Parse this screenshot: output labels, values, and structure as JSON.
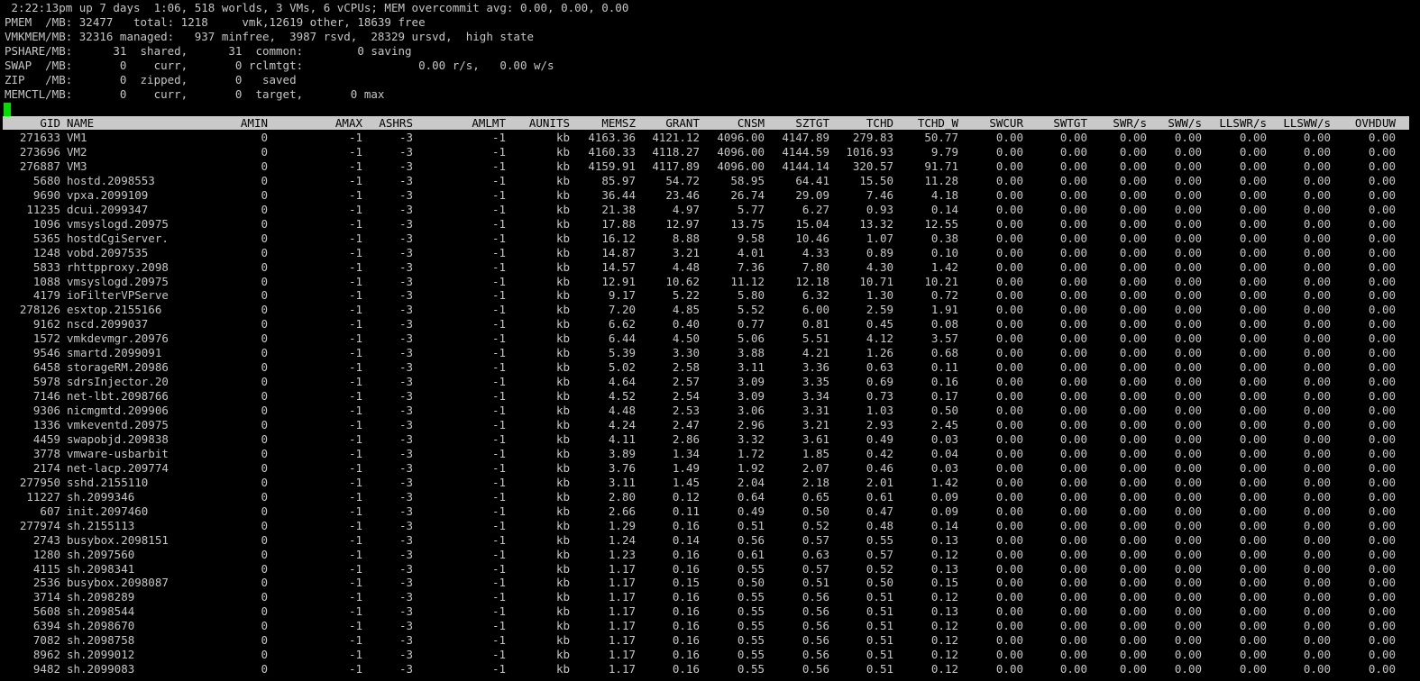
{
  "summary": {
    "line1": " 2:22:13pm up 7 days  1:06, 518 worlds, 3 VMs, 6 vCPUs; MEM overcommit avg: 0.00, 0.00, 0.00",
    "line2": "PMEM  /MB: 32477   total: 1218     vmk,12619 other, 18639 free",
    "line3": "VMKMEM/MB: 32316 managed:   937 minfree,  3987 rsvd,  28329 ursvd,  high state",
    "line4": "PSHARE/MB:      31  shared,      31  common:        0 saving",
    "line5": "SWAP  /MB:       0    curr,       0 rclmtgt:                 0.00 r/s,   0.00 w/s",
    "line6": "ZIP   /MB:       0  zipped,       0   saved",
    "line7": "MEMCTL/MB:       0    curr,       0  target,       0 max"
  },
  "columns": [
    "GID",
    "NAME",
    "AMIN",
    "AMAX",
    "ASHRS",
    "AMLMT",
    "AUNITS",
    "MEMSZ",
    "GRANT",
    "CNSM",
    "SZTGT",
    "TCHD",
    "TCHD_W",
    "SWCUR",
    "SWTGT",
    "SWR/s",
    "SWW/s",
    "LLSWR/s",
    "LLSWW/s",
    "OVHDUW"
  ],
  "rows": [
    [
      "271633",
      "VM1",
      "0",
      "-1",
      "-3",
      "-1",
      "kb",
      "4163.36",
      "4121.12",
      "4096.00",
      "4147.89",
      "279.83",
      "50.77",
      "0.00",
      "0.00",
      "0.00",
      "0.00",
      "0.00",
      "0.00",
      "0.00"
    ],
    [
      "273696",
      "VM2",
      "0",
      "-1",
      "-3",
      "-1",
      "kb",
      "4160.33",
      "4118.27",
      "4096.00",
      "4144.59",
      "1016.93",
      "9.79",
      "0.00",
      "0.00",
      "0.00",
      "0.00",
      "0.00",
      "0.00",
      "0.00"
    ],
    [
      "276887",
      "VM3",
      "0",
      "-1",
      "-3",
      "-1",
      "kb",
      "4159.91",
      "4117.89",
      "4096.00",
      "4144.14",
      "320.57",
      "91.71",
      "0.00",
      "0.00",
      "0.00",
      "0.00",
      "0.00",
      "0.00",
      "0.00"
    ],
    [
      "5680",
      "hostd.2098553",
      "0",
      "-1",
      "-3",
      "-1",
      "kb",
      "85.97",
      "54.72",
      "58.95",
      "64.41",
      "15.50",
      "11.28",
      "0.00",
      "0.00",
      "0.00",
      "0.00",
      "0.00",
      "0.00",
      "0.00"
    ],
    [
      "9690",
      "vpxa.2099109",
      "0",
      "-1",
      "-3",
      "-1",
      "kb",
      "36.44",
      "23.46",
      "26.74",
      "29.09",
      "7.46",
      "4.18",
      "0.00",
      "0.00",
      "0.00",
      "0.00",
      "0.00",
      "0.00",
      "0.00"
    ],
    [
      "11235",
      "dcui.2099347",
      "0",
      "-1",
      "-3",
      "-1",
      "kb",
      "21.38",
      "4.97",
      "5.77",
      "6.27",
      "0.93",
      "0.14",
      "0.00",
      "0.00",
      "0.00",
      "0.00",
      "0.00",
      "0.00",
      "0.00"
    ],
    [
      "1096",
      "vmsyslogd.20975",
      "0",
      "-1",
      "-3",
      "-1",
      "kb",
      "17.88",
      "12.97",
      "13.75",
      "15.04",
      "13.32",
      "12.55",
      "0.00",
      "0.00",
      "0.00",
      "0.00",
      "0.00",
      "0.00",
      "0.00"
    ],
    [
      "5365",
      "hostdCgiServer.",
      "0",
      "-1",
      "-3",
      "-1",
      "kb",
      "16.12",
      "8.88",
      "9.58",
      "10.46",
      "1.07",
      "0.38",
      "0.00",
      "0.00",
      "0.00",
      "0.00",
      "0.00",
      "0.00",
      "0.00"
    ],
    [
      "1248",
      "vobd.2097535",
      "0",
      "-1",
      "-3",
      "-1",
      "kb",
      "14.87",
      "3.21",
      "4.01",
      "4.33",
      "0.89",
      "0.10",
      "0.00",
      "0.00",
      "0.00",
      "0.00",
      "0.00",
      "0.00",
      "0.00"
    ],
    [
      "5833",
      "rhttpproxy.2098",
      "0",
      "-1",
      "-3",
      "-1",
      "kb",
      "14.57",
      "4.48",
      "7.36",
      "7.80",
      "4.30",
      "1.42",
      "0.00",
      "0.00",
      "0.00",
      "0.00",
      "0.00",
      "0.00",
      "0.00"
    ],
    [
      "1088",
      "vmsyslogd.20975",
      "0",
      "-1",
      "-3",
      "-1",
      "kb",
      "12.91",
      "10.62",
      "11.12",
      "12.18",
      "10.71",
      "10.21",
      "0.00",
      "0.00",
      "0.00",
      "0.00",
      "0.00",
      "0.00",
      "0.00"
    ],
    [
      "4179",
      "ioFilterVPServe",
      "0",
      "-1",
      "-3",
      "-1",
      "kb",
      "9.17",
      "5.22",
      "5.80",
      "6.32",
      "1.30",
      "0.72",
      "0.00",
      "0.00",
      "0.00",
      "0.00",
      "0.00",
      "0.00",
      "0.00"
    ],
    [
      "278126",
      "esxtop.2155166",
      "0",
      "-1",
      "-3",
      "-1",
      "kb",
      "7.20",
      "4.85",
      "5.52",
      "6.00",
      "2.59",
      "1.91",
      "0.00",
      "0.00",
      "0.00",
      "0.00",
      "0.00",
      "0.00",
      "0.00"
    ],
    [
      "9162",
      "nscd.2099037",
      "0",
      "-1",
      "-3",
      "-1",
      "kb",
      "6.62",
      "0.40",
      "0.77",
      "0.81",
      "0.45",
      "0.08",
      "0.00",
      "0.00",
      "0.00",
      "0.00",
      "0.00",
      "0.00",
      "0.00"
    ],
    [
      "1572",
      "vmkdevmgr.20976",
      "0",
      "-1",
      "-3",
      "-1",
      "kb",
      "6.44",
      "4.50",
      "5.06",
      "5.51",
      "4.12",
      "3.57",
      "0.00",
      "0.00",
      "0.00",
      "0.00",
      "0.00",
      "0.00",
      "0.00"
    ],
    [
      "9546",
      "smartd.2099091",
      "0",
      "-1",
      "-3",
      "-1",
      "kb",
      "5.39",
      "3.30",
      "3.88",
      "4.21",
      "1.26",
      "0.68",
      "0.00",
      "0.00",
      "0.00",
      "0.00",
      "0.00",
      "0.00",
      "0.00"
    ],
    [
      "6458",
      "storageRM.20986",
      "0",
      "-1",
      "-3",
      "-1",
      "kb",
      "5.02",
      "2.58",
      "3.11",
      "3.36",
      "0.63",
      "0.11",
      "0.00",
      "0.00",
      "0.00",
      "0.00",
      "0.00",
      "0.00",
      "0.00"
    ],
    [
      "5978",
      "sdrsInjector.20",
      "0",
      "-1",
      "-3",
      "-1",
      "kb",
      "4.64",
      "2.57",
      "3.09",
      "3.35",
      "0.69",
      "0.16",
      "0.00",
      "0.00",
      "0.00",
      "0.00",
      "0.00",
      "0.00",
      "0.00"
    ],
    [
      "7146",
      "net-lbt.2098766",
      "0",
      "-1",
      "-3",
      "-1",
      "kb",
      "4.52",
      "2.54",
      "3.09",
      "3.34",
      "0.73",
      "0.17",
      "0.00",
      "0.00",
      "0.00",
      "0.00",
      "0.00",
      "0.00",
      "0.00"
    ],
    [
      "9306",
      "nicmgmtd.209906",
      "0",
      "-1",
      "-3",
      "-1",
      "kb",
      "4.48",
      "2.53",
      "3.06",
      "3.31",
      "1.03",
      "0.50",
      "0.00",
      "0.00",
      "0.00",
      "0.00",
      "0.00",
      "0.00",
      "0.00"
    ],
    [
      "1336",
      "vmkeventd.20975",
      "0",
      "-1",
      "-3",
      "-1",
      "kb",
      "4.24",
      "2.47",
      "2.96",
      "3.21",
      "2.93",
      "2.45",
      "0.00",
      "0.00",
      "0.00",
      "0.00",
      "0.00",
      "0.00",
      "0.00"
    ],
    [
      "4459",
      "swapobjd.209838",
      "0",
      "-1",
      "-3",
      "-1",
      "kb",
      "4.11",
      "2.86",
      "3.32",
      "3.61",
      "0.49",
      "0.03",
      "0.00",
      "0.00",
      "0.00",
      "0.00",
      "0.00",
      "0.00",
      "0.00"
    ],
    [
      "3778",
      "vmware-usbarbit",
      "0",
      "-1",
      "-3",
      "-1",
      "kb",
      "3.89",
      "1.34",
      "1.72",
      "1.85",
      "0.42",
      "0.04",
      "0.00",
      "0.00",
      "0.00",
      "0.00",
      "0.00",
      "0.00",
      "0.00"
    ],
    [
      "2174",
      "net-lacp.209774",
      "0",
      "-1",
      "-3",
      "-1",
      "kb",
      "3.76",
      "1.49",
      "1.92",
      "2.07",
      "0.46",
      "0.03",
      "0.00",
      "0.00",
      "0.00",
      "0.00",
      "0.00",
      "0.00",
      "0.00"
    ],
    [
      "277950",
      "sshd.2155110",
      "0",
      "-1",
      "-3",
      "-1",
      "kb",
      "3.11",
      "1.45",
      "2.04",
      "2.18",
      "2.01",
      "1.42",
      "0.00",
      "0.00",
      "0.00",
      "0.00",
      "0.00",
      "0.00",
      "0.00"
    ],
    [
      "11227",
      "sh.2099346",
      "0",
      "-1",
      "-3",
      "-1",
      "kb",
      "2.80",
      "0.12",
      "0.64",
      "0.65",
      "0.61",
      "0.09",
      "0.00",
      "0.00",
      "0.00",
      "0.00",
      "0.00",
      "0.00",
      "0.00"
    ],
    [
      "607",
      "init.2097460",
      "0",
      "-1",
      "-3",
      "-1",
      "kb",
      "2.66",
      "0.11",
      "0.49",
      "0.50",
      "0.47",
      "0.09",
      "0.00",
      "0.00",
      "0.00",
      "0.00",
      "0.00",
      "0.00",
      "0.00"
    ],
    [
      "277974",
      "sh.2155113",
      "0",
      "-1",
      "-3",
      "-1",
      "kb",
      "1.29",
      "0.16",
      "0.51",
      "0.52",
      "0.48",
      "0.14",
      "0.00",
      "0.00",
      "0.00",
      "0.00",
      "0.00",
      "0.00",
      "0.00"
    ],
    [
      "2743",
      "busybox.2098151",
      "0",
      "-1",
      "-3",
      "-1",
      "kb",
      "1.24",
      "0.14",
      "0.56",
      "0.57",
      "0.55",
      "0.13",
      "0.00",
      "0.00",
      "0.00",
      "0.00",
      "0.00",
      "0.00",
      "0.00"
    ],
    [
      "1280",
      "sh.2097560",
      "0",
      "-1",
      "-3",
      "-1",
      "kb",
      "1.23",
      "0.16",
      "0.61",
      "0.63",
      "0.57",
      "0.12",
      "0.00",
      "0.00",
      "0.00",
      "0.00",
      "0.00",
      "0.00",
      "0.00"
    ],
    [
      "4115",
      "sh.2098341",
      "0",
      "-1",
      "-3",
      "-1",
      "kb",
      "1.17",
      "0.16",
      "0.55",
      "0.57",
      "0.52",
      "0.13",
      "0.00",
      "0.00",
      "0.00",
      "0.00",
      "0.00",
      "0.00",
      "0.00"
    ],
    [
      "2536",
      "busybox.2098087",
      "0",
      "-1",
      "-3",
      "-1",
      "kb",
      "1.17",
      "0.15",
      "0.50",
      "0.51",
      "0.50",
      "0.15",
      "0.00",
      "0.00",
      "0.00",
      "0.00",
      "0.00",
      "0.00",
      "0.00"
    ],
    [
      "3714",
      "sh.2098289",
      "0",
      "-1",
      "-3",
      "-1",
      "kb",
      "1.17",
      "0.16",
      "0.55",
      "0.56",
      "0.51",
      "0.12",
      "0.00",
      "0.00",
      "0.00",
      "0.00",
      "0.00",
      "0.00",
      "0.00"
    ],
    [
      "5608",
      "sh.2098544",
      "0",
      "-1",
      "-3",
      "-1",
      "kb",
      "1.17",
      "0.16",
      "0.55",
      "0.56",
      "0.51",
      "0.13",
      "0.00",
      "0.00",
      "0.00",
      "0.00",
      "0.00",
      "0.00",
      "0.00"
    ],
    [
      "6394",
      "sh.2098670",
      "0",
      "-1",
      "-3",
      "-1",
      "kb",
      "1.17",
      "0.16",
      "0.55",
      "0.56",
      "0.51",
      "0.12",
      "0.00",
      "0.00",
      "0.00",
      "0.00",
      "0.00",
      "0.00",
      "0.00"
    ],
    [
      "7082",
      "sh.2098758",
      "0",
      "-1",
      "-3",
      "-1",
      "kb",
      "1.17",
      "0.16",
      "0.55",
      "0.56",
      "0.51",
      "0.12",
      "0.00",
      "0.00",
      "0.00",
      "0.00",
      "0.00",
      "0.00",
      "0.00"
    ],
    [
      "8962",
      "sh.2099012",
      "0",
      "-1",
      "-3",
      "-1",
      "kb",
      "1.17",
      "0.16",
      "0.55",
      "0.56",
      "0.51",
      "0.12",
      "0.00",
      "0.00",
      "0.00",
      "0.00",
      "0.00",
      "0.00",
      "0.00"
    ],
    [
      "9482",
      "sh.2099083",
      "0",
      "-1",
      "-3",
      "-1",
      "kb",
      "1.17",
      "0.16",
      "0.55",
      "0.56",
      "0.51",
      "0.12",
      "0.00",
      "0.00",
      "0.00",
      "0.00",
      "0.00",
      "0.00",
      "0.00"
    ]
  ],
  "colors": {
    "background": "#000000",
    "text": "#c6c6c6",
    "header_bar": "#c9c9c9",
    "cursor": "#00dd00"
  }
}
